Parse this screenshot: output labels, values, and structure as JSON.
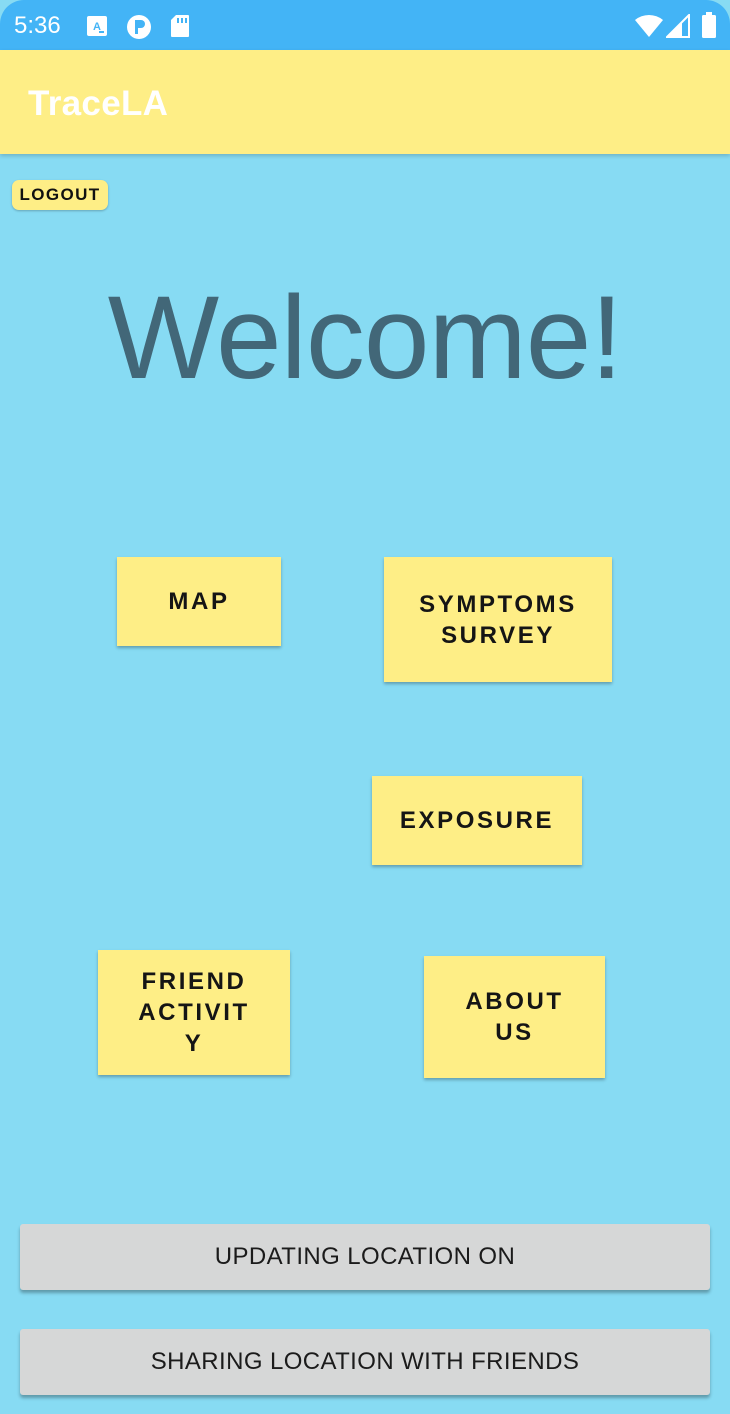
{
  "status_bar": {
    "time": "5:36",
    "icons": [
      "keyboard-a-icon",
      "circle-app-icon",
      "sd-card-icon",
      "wifi-icon",
      "cellular-signal-icon",
      "battery-icon"
    ]
  },
  "app_bar": {
    "title": "TraceLA"
  },
  "logout": {
    "label": "LOGOUT"
  },
  "welcome": {
    "text": "Welcome!"
  },
  "tiles": {
    "map": "MAP",
    "symptoms_survey": "SYMPTOMS\nSURVEY",
    "exposure": "EXPOSURE",
    "friend_activity": "FRIEND\nACTIVIT\nY",
    "about_us": "ABOUT\nUS"
  },
  "toggles": {
    "updating_location": "UPDATING LOCATION ON",
    "sharing_location": "SHARING LOCATION WITH FRIENDS"
  },
  "colors": {
    "background": "#87dbf3",
    "status_bar": "#43b4f6",
    "accent_yellow": "#feee86",
    "welcome_text": "#426778",
    "bar_gray": "#d6d7d7"
  }
}
